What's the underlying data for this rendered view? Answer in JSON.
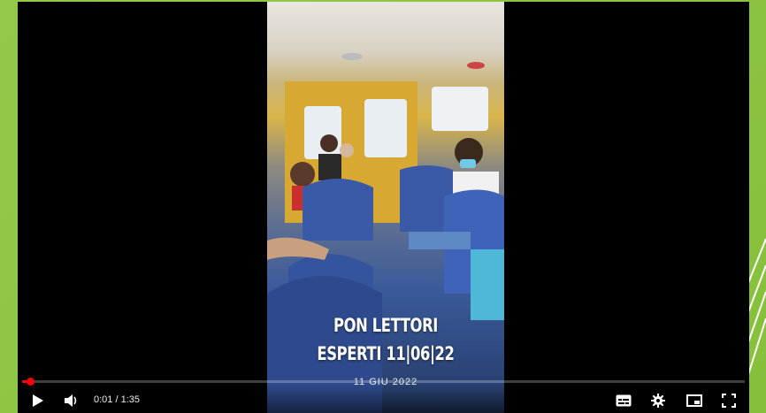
{
  "player": {
    "caption_line1": "PON LETTORI",
    "caption_line2": "ESPERTI 11|06|22",
    "caption_date": "11 GIU 2022",
    "time_display": "0:01 / 1:35",
    "progress_fraction": 0.0105
  },
  "icons": {
    "play": "play-icon",
    "volume": "volume-icon",
    "subtitles": "subtitles-icon",
    "settings": "gear-icon",
    "miniplayer": "miniplayer-icon",
    "fullscreen": "fullscreen-icon"
  },
  "colors": {
    "slide_background": "#8cc63f",
    "progress": "#ff0000"
  }
}
